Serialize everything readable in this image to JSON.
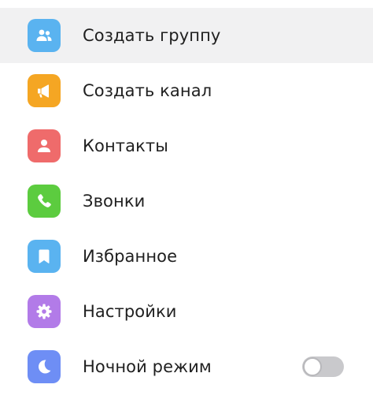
{
  "menu": {
    "items": [
      {
        "label": "Создать группу",
        "icon": "group-icon",
        "color": "#5ab3f0",
        "selected": true
      },
      {
        "label": "Создать канал",
        "icon": "megaphone-icon",
        "color": "#f5a623",
        "selected": false
      },
      {
        "label": "Контакты",
        "icon": "person-icon",
        "color": "#ef6b6b",
        "selected": false
      },
      {
        "label": "Звонки",
        "icon": "phone-icon",
        "color": "#5ccc3f",
        "selected": false
      },
      {
        "label": "Избранное",
        "icon": "bookmark-icon",
        "color": "#5ab3f0",
        "selected": false
      },
      {
        "label": "Настройки",
        "icon": "gear-icon",
        "color": "#b27be8",
        "selected": false
      },
      {
        "label": "Ночной режим",
        "icon": "moon-icon",
        "color": "#6e8ef5",
        "selected": false
      }
    ],
    "night_mode_enabled": false
  },
  "colors": {
    "selected_row_background": "#f1f1f2",
    "label_text": "#1f1f1f",
    "toggle_track_off": "#c9c9cc"
  }
}
